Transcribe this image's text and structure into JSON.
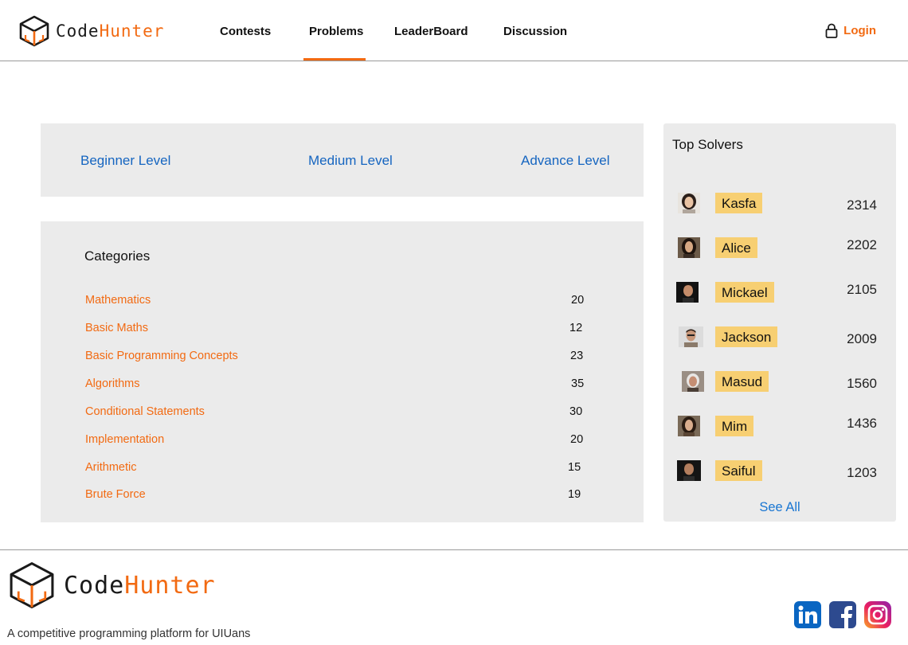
{
  "brand": {
    "part1": "Code",
    "part2": "Hunter"
  },
  "colors": {
    "accent": "#f26a12",
    "link": "#1565c0",
    "badge": "#f7cf72",
    "panel": "#ebebeb"
  },
  "nav": {
    "items": [
      {
        "label": "Contests"
      },
      {
        "label": "Problems",
        "active": true
      },
      {
        "label": "LeaderBoard"
      },
      {
        "label": "Discussion"
      }
    ],
    "login_label": "Login",
    "login_icon": "lock-icon"
  },
  "levels": [
    "Beginner Level",
    "Medium Level",
    "Advance Level"
  ],
  "categories": {
    "title": "Categories",
    "items": [
      {
        "name": "Mathematics",
        "count": "20"
      },
      {
        "name": "Basic Maths",
        "count": "12"
      },
      {
        "name": "Basic Programming Concepts",
        "count": "23"
      },
      {
        "name": "Algorithms",
        "count": "35"
      },
      {
        "name": "Conditional Statements",
        "count": "30"
      },
      {
        "name": "Implementation",
        "count": "20"
      },
      {
        "name": "Arithmetic",
        "count": "15"
      },
      {
        "name": "Brute Force",
        "count": "19"
      }
    ]
  },
  "top_solvers": {
    "title": "Top Solvers",
    "items": [
      {
        "name": "Kasfa",
        "score": "2314"
      },
      {
        "name": "Alice",
        "score": "2202"
      },
      {
        "name": "Mickael",
        "score": "2105"
      },
      {
        "name": "Jackson",
        "score": "2009"
      },
      {
        "name": "Masud",
        "score": "1560"
      },
      {
        "name": "Mim",
        "score": "1436"
      },
      {
        "name": "Saiful",
        "score": "1203"
      }
    ],
    "see_all": "See All"
  },
  "footer": {
    "tagline": "A competitive programming platform for UIUans",
    "socials": [
      "linkedin-icon",
      "facebook-icon",
      "instagram-icon"
    ]
  }
}
